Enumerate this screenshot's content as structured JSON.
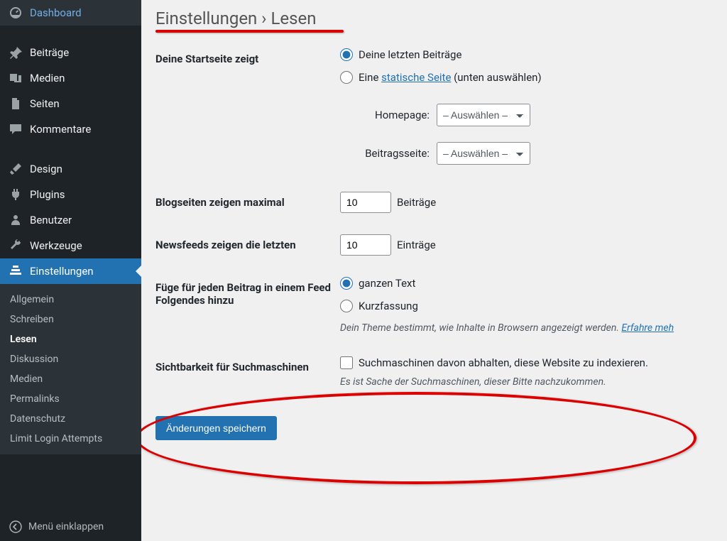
{
  "sidebar": {
    "items": [
      {
        "icon": "dashboard",
        "label": "Dashboard"
      },
      {
        "icon": "pin",
        "label": "Beiträge"
      },
      {
        "icon": "media",
        "label": "Medien"
      },
      {
        "icon": "pages",
        "label": "Seiten"
      },
      {
        "icon": "comments",
        "label": "Kommentare"
      },
      {
        "icon": "brush",
        "label": "Design"
      },
      {
        "icon": "plugins",
        "label": "Plugins"
      },
      {
        "icon": "users",
        "label": "Benutzer"
      },
      {
        "icon": "wrench",
        "label": "Werkzeuge"
      },
      {
        "icon": "settings",
        "label": "Einstellungen"
      }
    ],
    "submenu": [
      "Allgemein",
      "Schreiben",
      "Lesen",
      "Diskussion",
      "Medien",
      "Permalinks",
      "Datenschutz",
      "Limit Login Attempts"
    ],
    "collapse": "Menü einklappen"
  },
  "page": {
    "title_a": "Einstellungen",
    "title_sep": " › ",
    "title_b": "Lesen"
  },
  "form": {
    "startpage": {
      "label": "Deine Startseite zeigt",
      "opt1": "Deine letzten Beiträge",
      "opt2a": "Eine ",
      "opt2link": "statische Seite",
      "opt2b": " (unten auswählen)",
      "homepage_label": "Homepage:",
      "posts_label": "Beitragsseite:",
      "select_placeholder": "– Auswählen –"
    },
    "blogpages": {
      "label": "Blogseiten zeigen maximal",
      "value": "10",
      "unit": "Beiträge"
    },
    "newsfeeds": {
      "label": "Newsfeeds zeigen die letzten",
      "value": "10",
      "unit": "Einträge"
    },
    "feedcontent": {
      "label": "Füge für jeden Beitrag in einem Feed Folgendes hinzu",
      "opt1": "ganzen Text",
      "opt2": "Kurzfassung",
      "desc": "Dein Theme bestimmt, wie Inhalte in Browsern angezeigt werden. ",
      "desclink": "Erfahre meh"
    },
    "visibility": {
      "label": "Sichtbarkeit für Suchmaschinen",
      "checkbox": "Suchmaschinen davon abhalten, diese Website zu indexieren.",
      "desc": "Es ist Sache der Suchmaschinen, dieser Bitte nachzukommen."
    },
    "save": "Änderungen speichern"
  }
}
